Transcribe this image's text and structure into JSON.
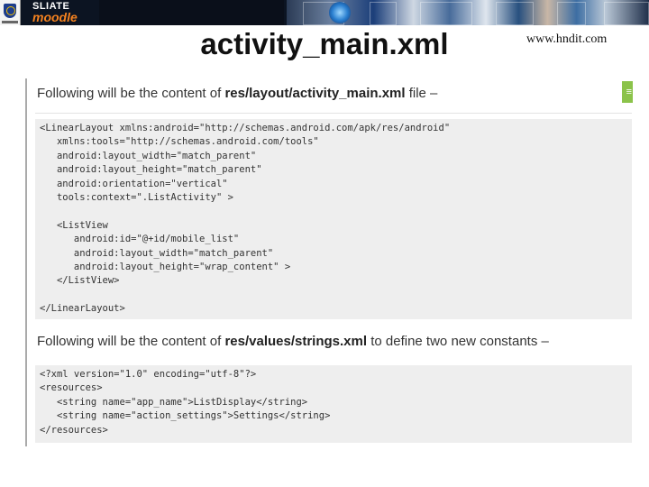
{
  "banner": {
    "brand_line1": "SLIATE",
    "brand_line2": "moodle"
  },
  "slide": {
    "title": "activity_main.xml",
    "site": "www.hndit.com"
  },
  "content": {
    "para1_pre": "Following will be the content of ",
    "para1_bold": "res/layout/activity_main.xml",
    "para1_post": " file –",
    "code1": [
      "<LinearLayout xmlns:android=\"http://schemas.android.com/apk/res/android\"",
      "   xmlns:tools=\"http://schemas.android.com/tools\"",
      "   android:layout_width=\"match_parent\"",
      "   android:layout_height=\"match_parent\"",
      "   android:orientation=\"vertical\"",
      "   tools:context=\".ListActivity\" >",
      "",
      "   <ListView",
      "      android:id=\"@+id/mobile_list\"",
      "      android:layout_width=\"match_parent\"",
      "      android:layout_height=\"wrap_content\" >",
      "   </ListView>",
      "",
      "</LinearLayout>"
    ],
    "para2_pre": "Following will be the content of ",
    "para2_bold": "res/values/strings.xml",
    "para2_post": " to define two new constants –",
    "code2": [
      "<?xml version=\"1.0\" encoding=\"utf-8\"?>",
      "<resources>",
      "   <string name=\"app_name\">ListDisplay</string>",
      "   <string name=\"action_settings\">Settings</string>",
      "</resources>"
    ],
    "badge_glyph": "≡"
  }
}
